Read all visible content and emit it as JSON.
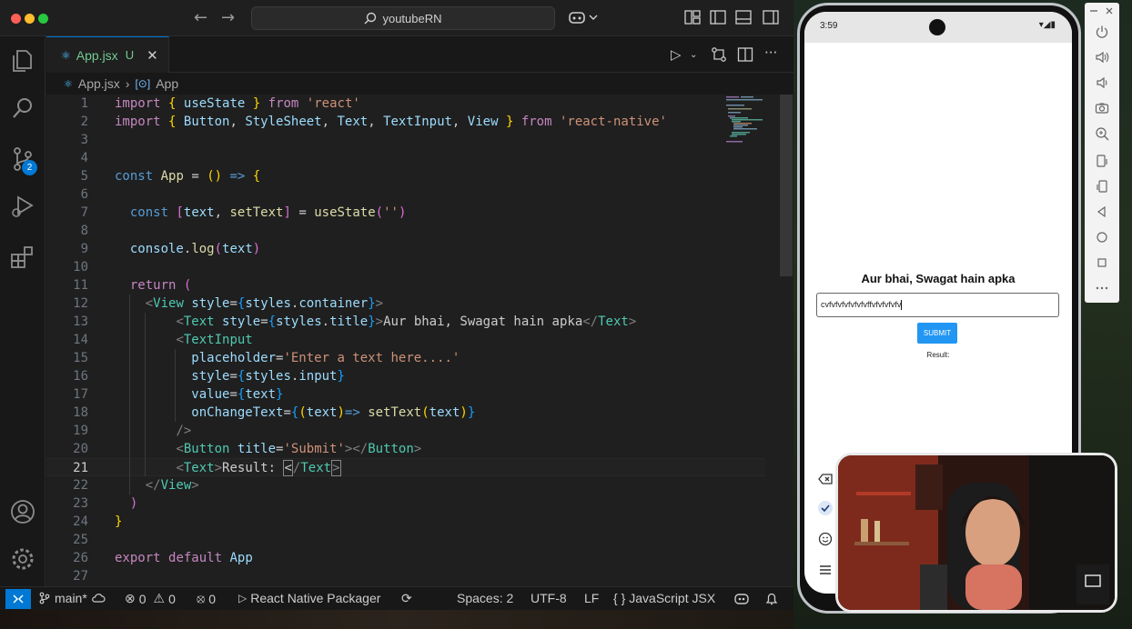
{
  "titlebar": {
    "search_text": "youtubeRN"
  },
  "activity": {
    "scm_badge": "2"
  },
  "tab": {
    "filename": "App.jsx",
    "status": "U"
  },
  "breadcrumb": {
    "file": "App.jsx",
    "symbol": "App"
  },
  "editor": {
    "current_line": 21,
    "line_numbers": [
      "1",
      "2",
      "3",
      "4",
      "5",
      "6",
      "7",
      "8",
      "9",
      "10",
      "11",
      "12",
      "13",
      "14",
      "15",
      "16",
      "17",
      "18",
      "19",
      "20",
      "21",
      "22",
      "23",
      "24",
      "25",
      "26",
      "27"
    ]
  },
  "statusbar": {
    "branch": "main*",
    "errors": "0",
    "warnings": "0",
    "ports": "0",
    "packager": "React Native Packager",
    "spaces": "Spaces: 2",
    "encoding": "UTF-8",
    "eol": "LF",
    "language": "JavaScript JSX"
  },
  "phone": {
    "time": "3:59",
    "app_title": "Aur bhai, Swagat hain apka",
    "input_value": "cvfvfvfvfvfvfvffvfvfvfvfv",
    "submit_label": "SUBMIT",
    "result_label": "Result:"
  },
  "colors": {
    "accent": "#0078d4",
    "editor_bg": "#1f1f1f",
    "button_blue": "#2196f3",
    "keyword": "#c586c0",
    "string": "#ce9178",
    "variable": "#9cdcfe",
    "component": "#4ec9b0"
  },
  "icons": [
    "explorer-icon",
    "search-icon",
    "source-control-icon",
    "run-debug-icon",
    "extensions-icon",
    "account-icon",
    "settings-icon",
    "run-icon",
    "compare-icon",
    "split-editor-icon",
    "more-icon",
    "copilot-icon",
    "layout-icon"
  ]
}
